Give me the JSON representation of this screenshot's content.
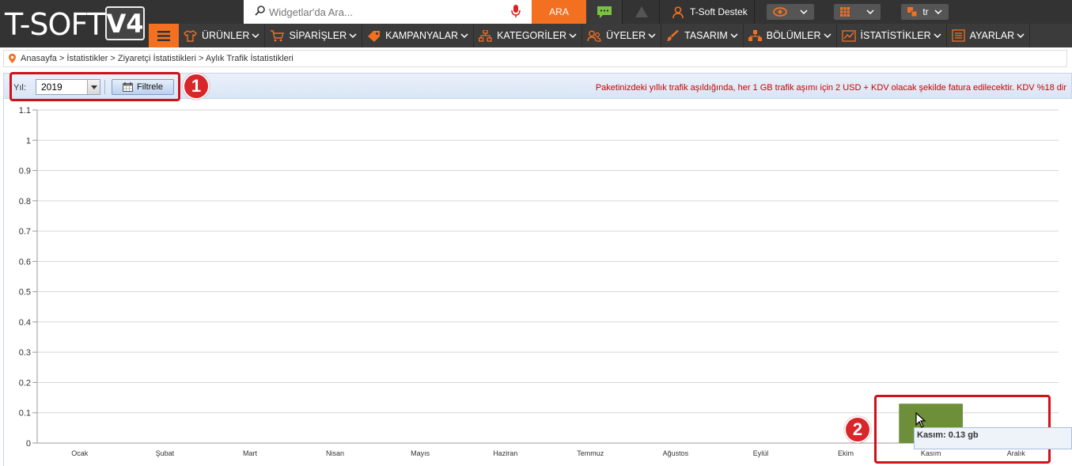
{
  "brand": {
    "logo_text": "T-SOFT",
    "logo_badge": "V4"
  },
  "search": {
    "placeholder": "Widgetlar'da Ara...",
    "button_label": "ARA"
  },
  "topbar": {
    "support_label": "T-Soft Destek",
    "language": "tr"
  },
  "nav": {
    "items": [
      {
        "label": "ÜRÜNLER"
      },
      {
        "label": "SİPARİŞLER"
      },
      {
        "label": "KAMPANYALAR"
      },
      {
        "label": "KATEGORİLER"
      },
      {
        "label": "ÜYELER"
      },
      {
        "label": "TASARIM"
      },
      {
        "label": "BÖLÜMLER"
      },
      {
        "label": "İSTATİSTİKLER"
      },
      {
        "label": "AYARLAR"
      }
    ]
  },
  "breadcrumb": {
    "text": "Anasayfa > İstatistikler > Ziyaretçi İstatistikleri > Aylık Trafik İstatistikleri"
  },
  "filter": {
    "year_label": "Yıl:",
    "year_value": "2019",
    "filter_button": "Filtrele",
    "notice": "Paketinizdeki yıllık trafik aşıldığında, her 1 GB trafik aşımı için 2 USD + KDV olacak şekilde fatura edilecektir. KDV %18 dir"
  },
  "annotations": {
    "marker1": "1",
    "marker2": "2"
  },
  "tooltip": {
    "text": "Kasım: 0.13 gb"
  },
  "colors": {
    "accent": "#f37021",
    "bar": "#6e8f3a",
    "annotation": "#d0101a"
  },
  "chart_data": {
    "type": "bar",
    "categories": [
      "Ocak",
      "Şubat",
      "Mart",
      "Nisan",
      "Mayıs",
      "Haziran",
      "Temmuz",
      "Ağustos",
      "Eylül",
      "Ekim",
      "Kasım",
      "Aralık"
    ],
    "values": [
      0,
      0,
      0,
      0,
      0,
      0,
      0,
      0,
      0,
      0,
      0.13,
      0
    ],
    "y_ticks": [
      "0",
      "0.1",
      "0.2",
      "0.3",
      "0.4",
      "0.5",
      "0.6",
      "0.7",
      "0.8",
      "0.9",
      "1",
      "1.1"
    ],
    "ylim": [
      0,
      1.1
    ],
    "grid": true,
    "unit": "gb"
  }
}
